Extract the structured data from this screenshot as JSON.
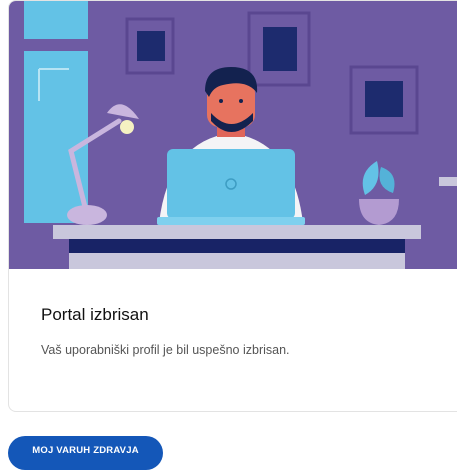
{
  "card": {
    "title": "Portal izbrisan",
    "message": "Vaš uporabniški profil je bil uspešno izbrisan."
  },
  "actions": {
    "primary_label": "MOJ VARUH ZDRAVJA"
  },
  "colors": {
    "accent": "#1457b8",
    "illustration_wall": "#6e5ba3",
    "illustration_window": "#63c2e6"
  },
  "icons": [
    "person-at-laptop-illustration",
    "desk-lamp-icon",
    "plant-icon",
    "picture-frame-icon"
  ]
}
